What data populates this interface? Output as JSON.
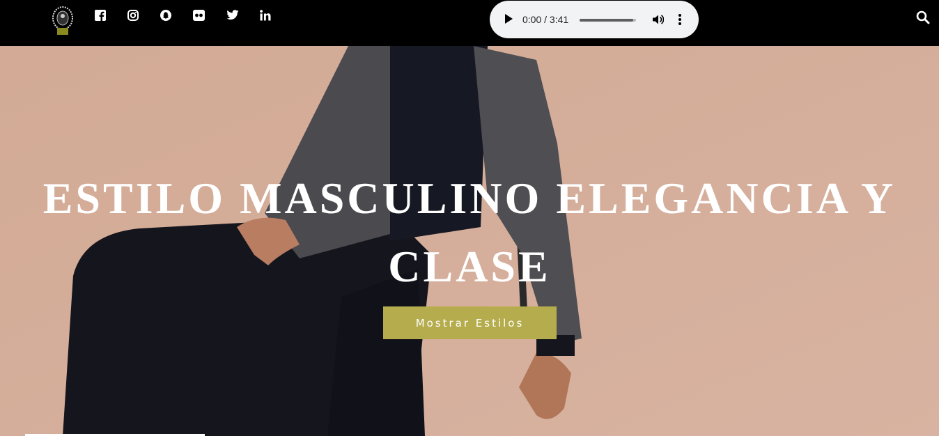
{
  "topbar": {
    "logo_name": "site-logo",
    "social": [
      {
        "name": "facebook-icon"
      },
      {
        "name": "instagram-icon"
      },
      {
        "name": "snapchat-icon"
      },
      {
        "name": "flickr-icon"
      },
      {
        "name": "twitter-icon"
      },
      {
        "name": "linkedin-icon"
      }
    ],
    "search_icon": "search-icon"
  },
  "audio_player": {
    "time": "0:00 / 3:41",
    "volume_level": 0.95
  },
  "hero": {
    "title": "ESTILO MASCULINO ELEGANCIA Y CLASE",
    "button_label": "Mostrar Estilos"
  },
  "colors": {
    "topbar": "#000000",
    "hero_bg": "#d4ac98",
    "button": "#b5ad4d",
    "title": "#ffffff"
  }
}
